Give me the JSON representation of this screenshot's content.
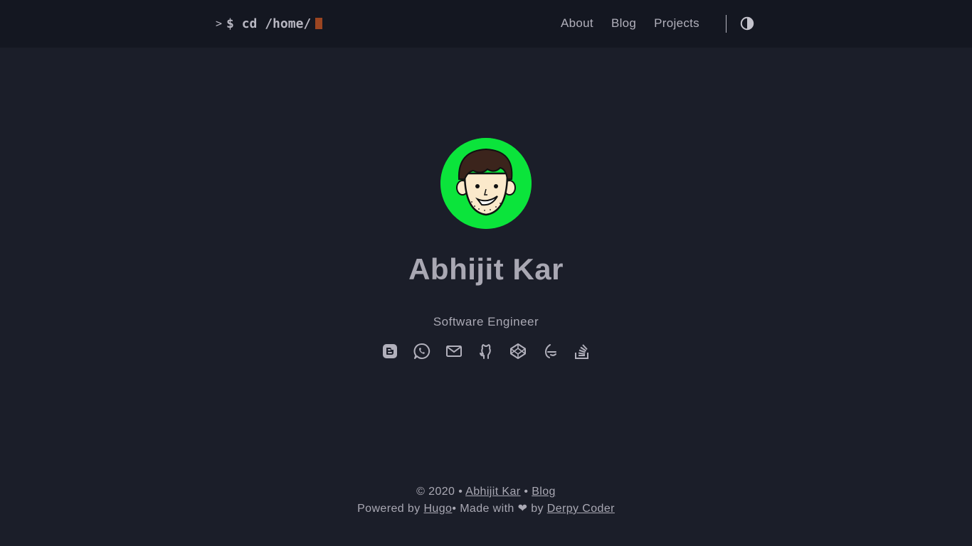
{
  "header": {
    "logo_prompt": ">",
    "logo_text": "$ cd /home/",
    "nav": [
      "About",
      "Blog",
      "Projects"
    ],
    "theme_icon": "contrast-icon"
  },
  "profile": {
    "avatar_icon": "avatar-cartoon-face",
    "name": "Abhijit Kar",
    "tagline": "Software Engineer"
  },
  "socials": [
    {
      "name": "blogger-icon"
    },
    {
      "name": "whatsapp-icon"
    },
    {
      "name": "mail-icon"
    },
    {
      "name": "github-icon"
    },
    {
      "name": "codepen-icon"
    },
    {
      "name": "freecodecamp-icon"
    },
    {
      "name": "stackoverflow-icon"
    }
  ],
  "footer": {
    "copyright": "© 2020 •",
    "author": "Abhijit Kar",
    "sep1": "•",
    "blog": "Blog",
    "powered_by": "Powered by",
    "hugo": "Hugo",
    "sep2": "•",
    "made_with": "Made with ❤ by",
    "derpy": "Derpy Coder"
  },
  "colors": {
    "background": "#1b1e29",
    "header": "#141721",
    "text": "#a9a8b3",
    "cursor": "#9b4521",
    "avatar_bg": "#0be43b"
  }
}
